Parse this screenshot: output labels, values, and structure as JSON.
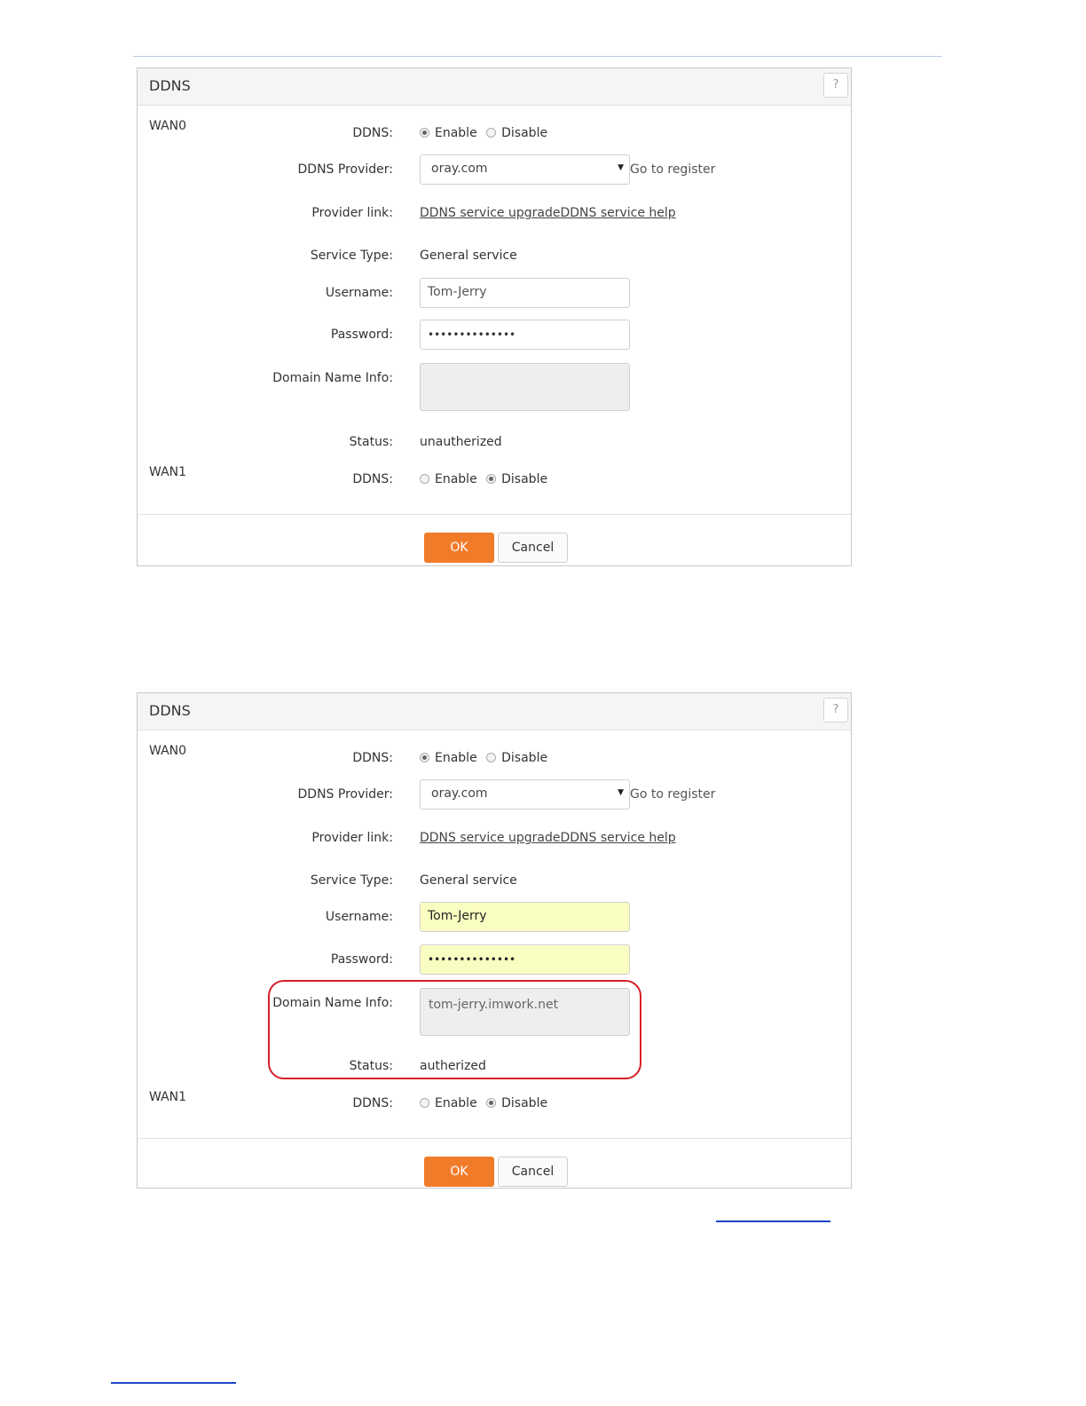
{
  "panels": [
    {
      "title": "DDNS",
      "help": "?",
      "wan0": {
        "name": "WAN0",
        "ddns_label": "DDNS:",
        "enable": "Enable",
        "disable": "Disable",
        "provider_label": "DDNS Provider:",
        "provider_value": "oray.com",
        "register_link": "Go to register",
        "provider_link_label": "Provider link:",
        "provider_link_1": "DDNS service upgrade",
        "provider_link_2": "DDNS service help",
        "service_type_label": "Service Type:",
        "service_type_value": "General service",
        "username_label": "Username:",
        "username_value": "Tom-Jerry",
        "password_label": "Password:",
        "password_value": "••••••••••••••",
        "domain_label": "Domain Name Info:",
        "domain_value": "",
        "status_label": "Status:",
        "status_value": "unautherized"
      },
      "wan1": {
        "name": "WAN1",
        "ddns_label": "DDNS:",
        "enable": "Enable",
        "disable": "Disable"
      },
      "ok": "OK",
      "cancel": "Cancel"
    },
    {
      "title": "DDNS",
      "help": "?",
      "wan0": {
        "name": "WAN0",
        "ddns_label": "DDNS:",
        "enable": "Enable",
        "disable": "Disable",
        "provider_label": "DDNS Provider:",
        "provider_value": "oray.com",
        "register_link": "Go to register",
        "provider_link_label": "Provider link:",
        "provider_link_1": "DDNS service upgrade",
        "provider_link_2": "DDNS service help",
        "service_type_label": "Service Type:",
        "service_type_value": "General service",
        "username_label": "Username:",
        "username_value": "Tom-Jerry",
        "password_label": "Password:",
        "password_value": "••••••••••••••",
        "domain_label": "Domain Name Info:",
        "domain_value": "tom-jerry.imwork.net",
        "status_label": "Status:",
        "status_value": "autherized"
      },
      "wan1": {
        "name": "WAN1",
        "ddns_label": "DDNS:",
        "enable": "Enable",
        "disable": "Disable"
      },
      "ok": "OK",
      "cancel": "Cancel"
    }
  ],
  "colors": {
    "ok_button": "#f07c2a",
    "autofill_bg": "#fafdc1",
    "highlight_border": "#d61f26",
    "footer_link_rule": "#1c46c4"
  }
}
